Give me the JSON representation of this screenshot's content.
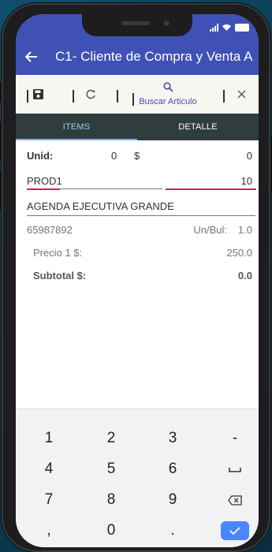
{
  "app": {
    "title": "C1- Cliente de Compra y Venta A"
  },
  "toolbar": {
    "search_label": "Buscar Articulo",
    "save_icon": "save-icon",
    "refresh_icon": "refresh-icon",
    "close_icon": "close-icon"
  },
  "tabs": [
    {
      "label": "ITEMS",
      "active": true
    },
    {
      "label": "DETALLE",
      "active": false
    }
  ],
  "form": {
    "unid_label": "Unid:",
    "unid_value": "0",
    "currency_symbol": "$",
    "amount_value": "0",
    "product_code": "PROD1",
    "quantity": "10",
    "product_name": "AGENDA EJECUTIVA GRANDE",
    "barcode": "65987892",
    "un_bul_label": "Un/Bul:",
    "un_bul_value": "1.0",
    "price_label": "Precio 1 $:",
    "price_value": "250.0",
    "subtotal_label": "Subtotal $:",
    "subtotal_value": "0.0"
  },
  "keypad": {
    "keys": [
      "1",
      "2",
      "3",
      "-",
      "4",
      "5",
      "6",
      "␣",
      "7",
      "8",
      "9",
      "⌫",
      ",",
      "0",
      ".",
      "✓"
    ]
  },
  "colors": {
    "app_bar": "#3f51b5",
    "tabs_bg": "#303d3d",
    "accent_tab": "#9ec6ff",
    "underline_error": "#d81b60",
    "done_key": "#4a86ff"
  }
}
